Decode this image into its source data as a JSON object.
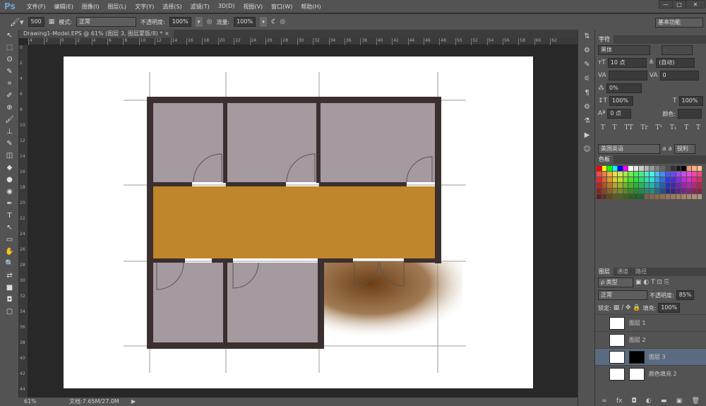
{
  "app": {
    "logo": "Ps"
  },
  "menu": [
    "文件(F)",
    "编辑(E)",
    "图像(I)",
    "图层(L)",
    "文字(Y)",
    "选择(S)",
    "滤镜(T)",
    "3D(D)",
    "视图(V)",
    "窗口(W)",
    "帮助(H)"
  ],
  "window_controls": {
    "minimize": "—",
    "maximize": "□",
    "close": "✕"
  },
  "options": {
    "brush_size": "500",
    "mode_label": "模式:",
    "mode_value": "正常",
    "opacity_label": "不透明度:",
    "opacity_value": "100%",
    "flow_label": "流量:",
    "flow_value": "100%",
    "workspace": "基本功能"
  },
  "document": {
    "tab_title": "Drawing1-Model.EPS @ 61% (图层 3, 图层蒙版/8) *",
    "close": "×"
  },
  "ruler": {
    "h_ticks": [
      "4",
      "2",
      "0",
      "2",
      "4",
      "6",
      "8",
      "10",
      "12",
      "14",
      "16",
      "18",
      "20",
      "22",
      "24",
      "26",
      "28",
      "30",
      "32",
      "34",
      "36",
      "38",
      "40",
      "42",
      "44",
      "46",
      "48",
      "50",
      "52",
      "54",
      "56",
      "58",
      "60",
      "62"
    ],
    "v_ticks": [
      "0",
      "2",
      "4",
      "6",
      "8",
      "10",
      "12",
      "14",
      "16",
      "18",
      "20",
      "22",
      "24",
      "26",
      "28",
      "30",
      "32",
      "34",
      "36",
      "38",
      "40",
      "42",
      "44"
    ]
  },
  "status": {
    "zoom": "61%",
    "doc_info": "文档:7.65M/27.0M"
  },
  "character": {
    "tab": "字符",
    "font": "黑体",
    "style": "-",
    "size": "10 点",
    "leading": "(自动)",
    "kerning": "",
    "tracking": "0",
    "scale_pct": "0%",
    "vscale": "100%",
    "hscale": "100%",
    "baseline": "0 点",
    "color_label": "颜色:",
    "styles": [
      "T",
      "T",
      "TT",
      "Tr",
      "T¹",
      "T₁",
      "T",
      "T"
    ],
    "language": "美国英语",
    "aa_label": "a a",
    "antialias": "锐利"
  },
  "swatches": {
    "tab": "色板"
  },
  "layers": {
    "tabs": [
      "图层",
      "通道",
      "路径"
    ],
    "filter": "ρ 类型",
    "blend": "正常",
    "opacity_label": "不透明度:",
    "opacity": "85%",
    "lock_label": "锁定:",
    "fill_label": "填充:",
    "fill": "100%",
    "items": [
      {
        "name": "图层 1"
      },
      {
        "name": "图层 2"
      },
      {
        "name": "图层 3"
      },
      {
        "name": "颜色填充 2"
      }
    ],
    "bottom_icons": [
      "∞",
      "fx",
      "◘",
      "◐",
      "▬",
      "▣",
      "🗑"
    ]
  },
  "colors": {
    "wall": "#3b2f2f",
    "room": "#a59aa0",
    "corridor": "#c0862b",
    "shadow": "#7a4a1c"
  }
}
